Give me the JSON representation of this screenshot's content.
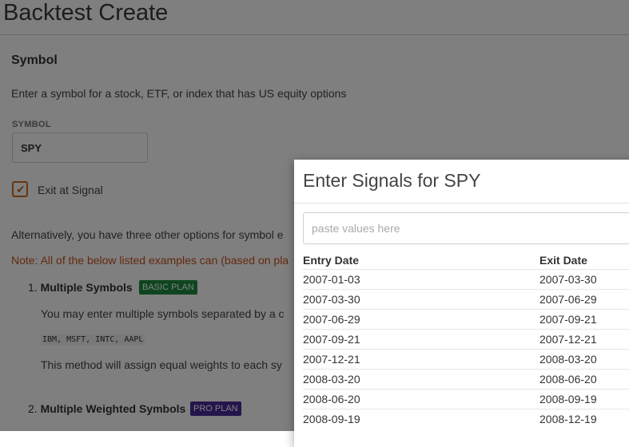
{
  "page": {
    "title": "Backtest Create",
    "section_heading": "Symbol",
    "intro": "Enter a symbol for a stock, ETF, or index that has US equity options",
    "symbol_label": "SYMBOL",
    "symbol_value": "SPY",
    "exit_signal_label": "Exit at Signal",
    "alternatives_text": "Alternatively, you have three other options for symbol e",
    "note_text": "Note: All of the below listed examples can (based on pla",
    "items": [
      {
        "number": "1.",
        "title": "Multiple Symbols",
        "badge": "BASIC PLAN",
        "description": "You may enter multiple symbols separated by a c",
        "example": "IBM, MSFT, INTC, AAPL",
        "method": "This method will assign equal weights to each sy"
      },
      {
        "number": "2.",
        "title": "Multiple Weighted Symbols",
        "badge": "PRO PLAN"
      }
    ]
  },
  "modal": {
    "title": "Enter Signals for SPY",
    "paste_placeholder": "paste values here",
    "columns": [
      "Entry Date",
      "Exit Date"
    ],
    "rows": [
      [
        "2007-01-03",
        "2007-03-30"
      ],
      [
        "2007-03-30",
        "2007-06-29"
      ],
      [
        "2007-06-29",
        "2007-09-21"
      ],
      [
        "2007-09-21",
        "2007-12-21"
      ],
      [
        "2007-12-21",
        "2008-03-20"
      ],
      [
        "2008-03-20",
        "2008-06-20"
      ],
      [
        "2008-06-20",
        "2008-09-19"
      ],
      [
        "2008-09-19",
        "2008-12-19"
      ]
    ]
  },
  "colors": {
    "accent_orange": "#d06a1e",
    "note_orange": "#c8531c",
    "basic_plan_green": "#1d8a3e",
    "pro_plan_purple": "#4a2a98"
  }
}
